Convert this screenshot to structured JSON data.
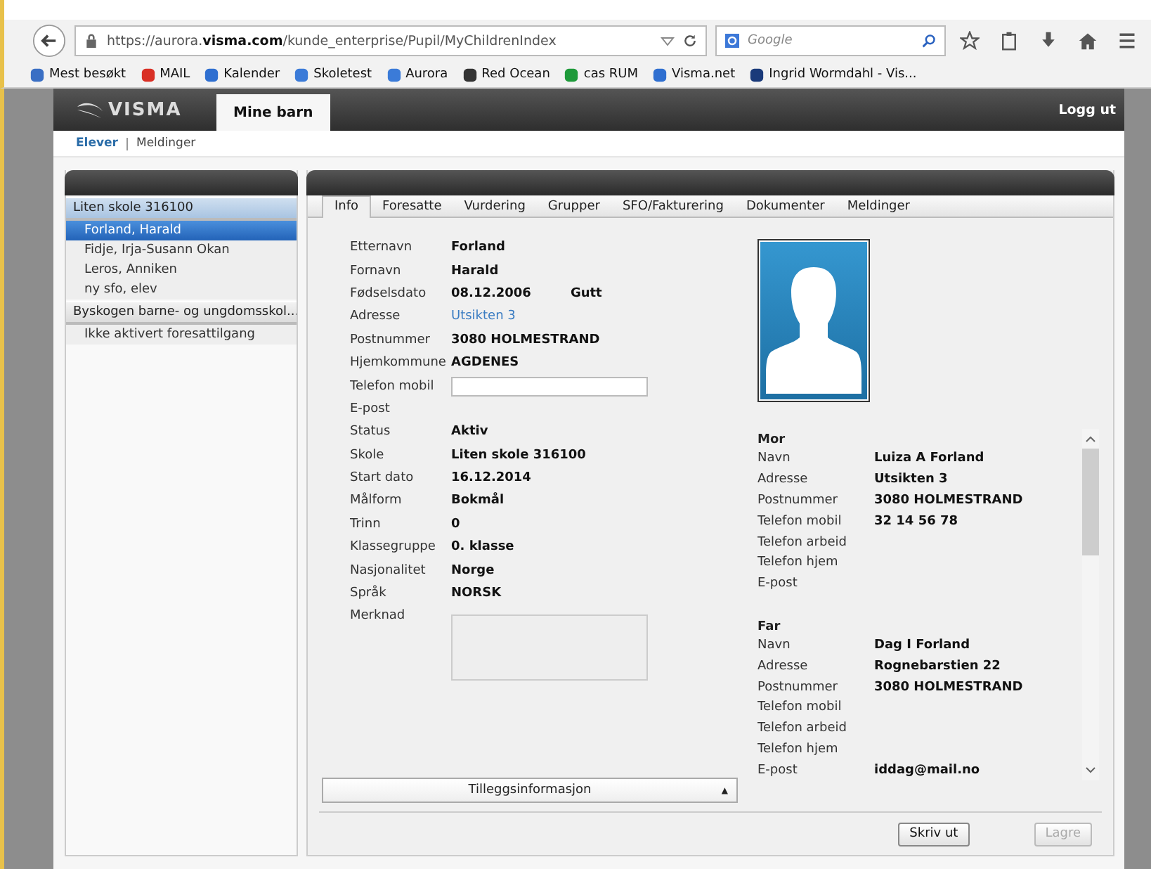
{
  "browser": {
    "url": "https://aurora.**visma.com**/kunde_enterprise/Pupil/MyChildrenIndex",
    "search": {
      "placeholder": "Google"
    },
    "bookmarks": [
      "Mest besøkt",
      "MAIL",
      "Kalender",
      "Skoletest",
      "Aurora",
      "Red Ocean",
      "cas RUM",
      "Visma.net",
      "Ingrid Wormdahl - Vis..."
    ]
  },
  "header": {
    "logo": "VISMA",
    "tabs": [
      {
        "label": "Mine barn",
        "selected": true
      }
    ],
    "logout": "Logg ut"
  },
  "subnav": [
    {
      "label": "Elever",
      "selected": true
    },
    {
      "label": "Meldinger",
      "selected": false
    }
  ],
  "sidebar": {
    "groups": [
      {
        "title": "Liten skole 316100",
        "items": [
          {
            "label": "Forland, Harald",
            "selected": true
          },
          {
            "label": "Fidje, Irja-Susann Okan",
            "selected": false
          },
          {
            "label": "Leros, Anniken",
            "selected": false
          },
          {
            "label": "ny sfo, elev",
            "selected": false
          }
        ]
      },
      {
        "title": "Byskogen barne- og ungdomsskol...",
        "items": [
          {
            "label": "Ikke aktivert foresattilgang",
            "selected": false
          }
        ]
      }
    ]
  },
  "tabs": [
    {
      "label": "Info",
      "selected": true
    },
    {
      "label": "Foresatte",
      "selected": false
    },
    {
      "label": "Vurdering",
      "selected": false
    },
    {
      "label": "Grupper",
      "selected": false
    },
    {
      "label": "SFO/Fakturering",
      "selected": false
    },
    {
      "label": "Dokumenter",
      "selected": false
    },
    {
      "label": "Meldinger",
      "selected": false
    }
  ],
  "fields": [
    {
      "label": "Etternavn",
      "kind": "text",
      "value": "Forland"
    },
    {
      "label": "Fornavn",
      "kind": "text",
      "value": "Harald"
    },
    {
      "label": "Fødselsdato",
      "kind": "text",
      "value": "08.12.2006",
      "extra": "Gutt"
    },
    {
      "label": "Adresse",
      "kind": "link",
      "value": "Utsikten 3"
    },
    {
      "label": "Postnummer",
      "kind": "text",
      "value": "3080 HOLMESTRAND"
    },
    {
      "label": "Hjemkommune",
      "kind": "text",
      "value": "AGDENES"
    },
    {
      "label": "Telefon mobil",
      "kind": "input"
    },
    {
      "label": "E-post",
      "kind": "text"
    },
    {
      "label": "Status",
      "kind": "text",
      "value": "Aktiv"
    },
    {
      "label": "Skole",
      "kind": "text",
      "value": "Liten skole 316100"
    },
    {
      "label": "Start dato",
      "kind": "text",
      "value": "16.12.2014"
    },
    {
      "label": "Målform",
      "kind": "text",
      "value": "Bokmål"
    },
    {
      "label": "Trinn",
      "kind": "text",
      "value": "0"
    },
    {
      "label": "Klassegruppe",
      "kind": "text",
      "value": "0. klasse"
    },
    {
      "label": "Nasjonalitet",
      "kind": "text",
      "value": "Norge"
    },
    {
      "label": "Språk",
      "kind": "text",
      "value": "NORSK"
    },
    {
      "label": "Merknad",
      "kind": "textarea"
    }
  ],
  "parents": [
    {
      "title": "Mor",
      "rows": [
        {
          "label": "Navn",
          "value": "Luiza A Forland"
        },
        {
          "label": "Adresse",
          "value": "Utsikten 3"
        },
        {
          "label": "Postnummer",
          "value": "3080 HOLMESTRAND"
        },
        {
          "label": "Telefon mobil",
          "value": "32 14 56 78"
        },
        {
          "label": "Telefon arbeid"
        },
        {
          "label": "Telefon hjem"
        },
        {
          "label": "E-post"
        }
      ]
    },
    {
      "title": "Far",
      "rows": [
        {
          "label": "Navn",
          "value": "Dag I Forland"
        },
        {
          "label": "Adresse",
          "value": "Rognebarstien 22"
        },
        {
          "label": "Postnummer",
          "value": "3080 HOLMESTRAND"
        },
        {
          "label": "Telefon mobil"
        },
        {
          "label": "Telefon arbeid"
        },
        {
          "label": "Telefon hjem"
        },
        {
          "label": "E-post",
          "value": "iddag@mail.no"
        }
      ]
    }
  ],
  "expander": {
    "label": "Tilleggsinformasjon",
    "arrow": "▲"
  },
  "buttons": [
    {
      "label": "Skriv ut",
      "disabled": false
    },
    {
      "label": "Lagre",
      "disabled": true
    }
  ]
}
